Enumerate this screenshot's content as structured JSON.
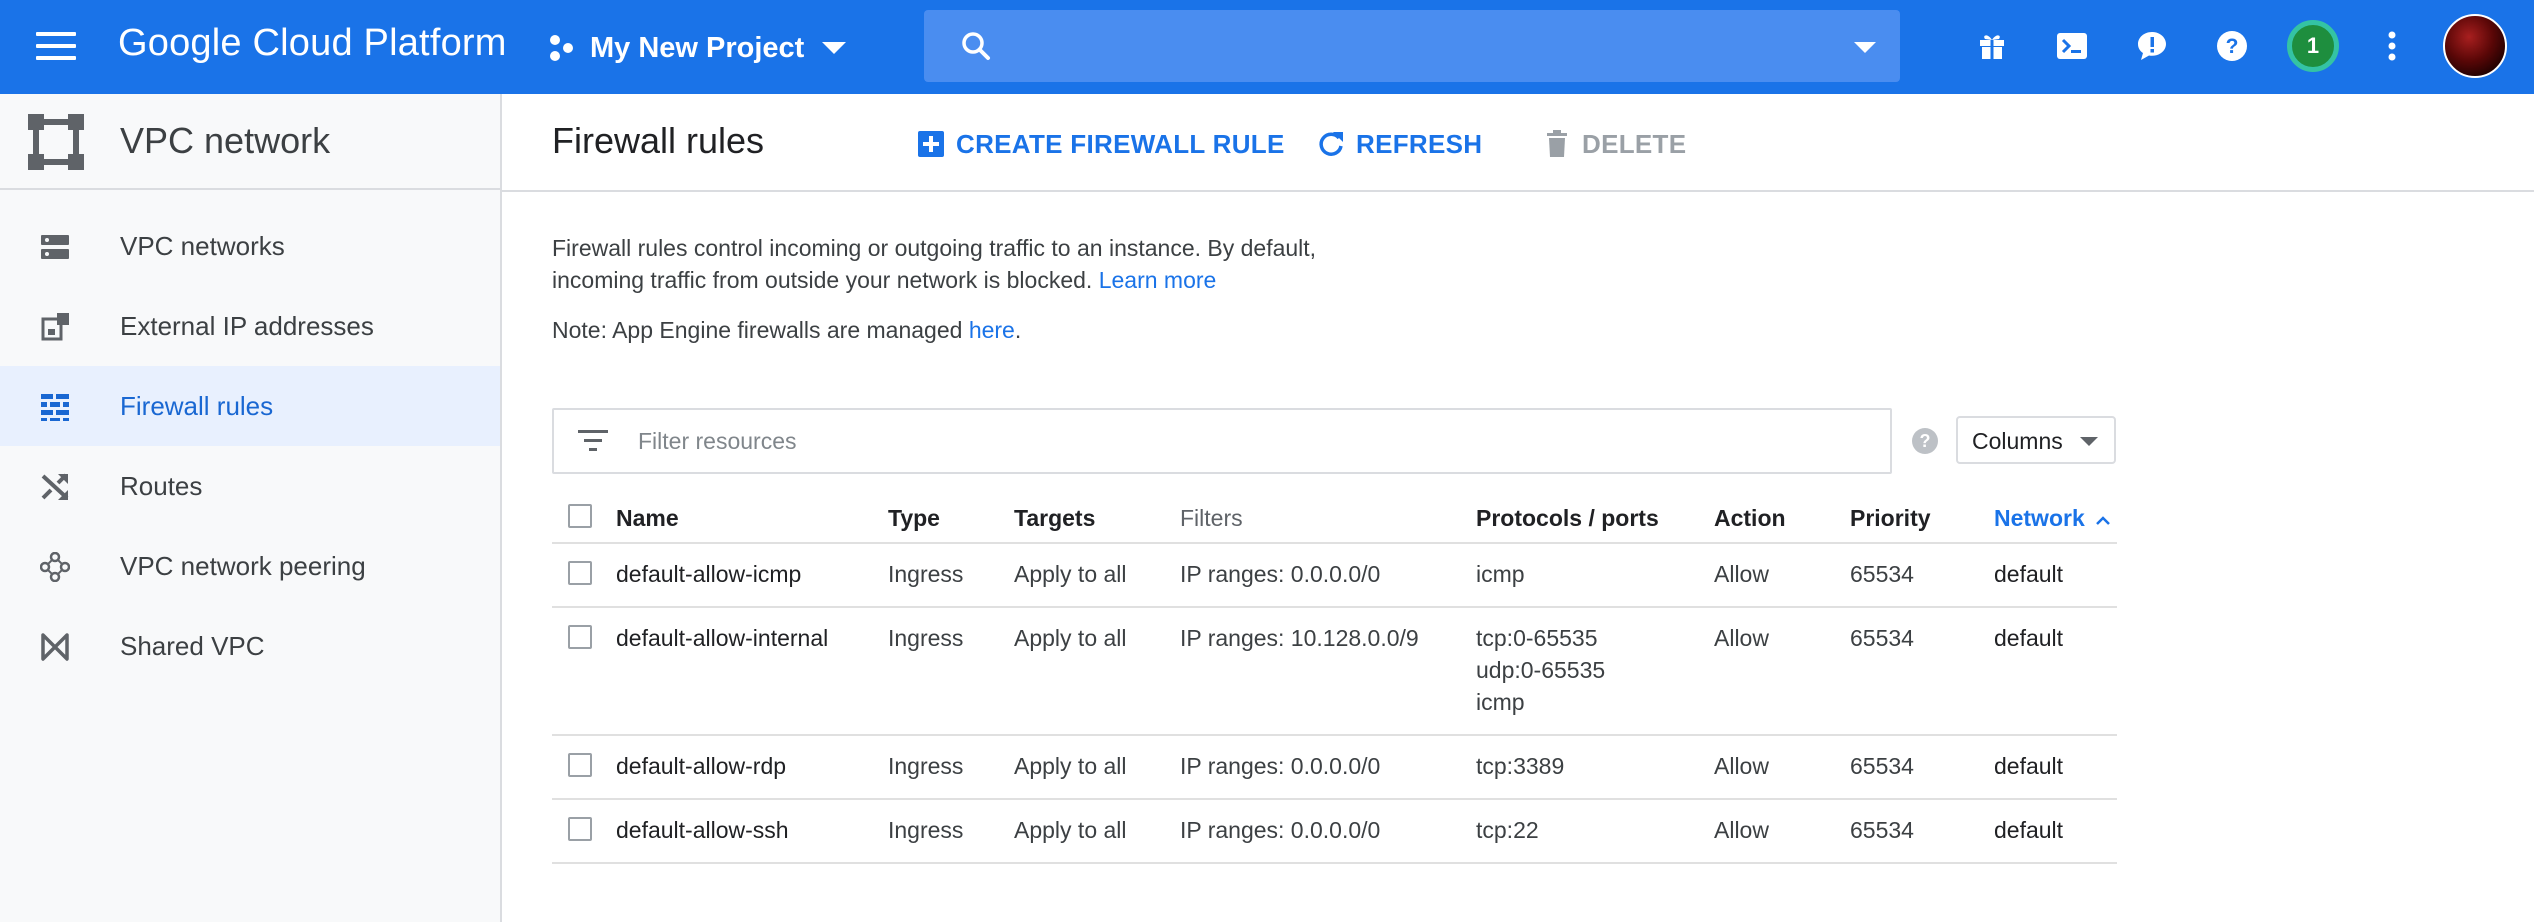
{
  "colors": {
    "topbar": "#1a73e8",
    "accent": "#1a73e8",
    "sidebar_bg": "#f8f9fa",
    "active_bg": "#e8f0fe",
    "notification_ring": "#34c3a4"
  },
  "topbar": {
    "menu_icon": "hamburger-menu-icon",
    "brand": "Google Cloud Platform",
    "project_name": "My New Project",
    "search_placeholder": "",
    "notification_count": "1",
    "icons": [
      "gift-icon",
      "cloud-shell-icon",
      "feedback-icon",
      "help-icon",
      "notifications-badge",
      "more-vert-icon",
      "account-avatar"
    ]
  },
  "sidebar": {
    "title": "VPC network",
    "items": [
      {
        "label": "VPC networks",
        "icon": "vpc-networks-icon"
      },
      {
        "label": "External IP addresses",
        "icon": "external-ip-icon"
      },
      {
        "label": "Firewall rules",
        "icon": "firewall-icon",
        "active": true
      },
      {
        "label": "Routes",
        "icon": "routes-icon"
      },
      {
        "label": "VPC network peering",
        "icon": "peering-icon"
      },
      {
        "label": "Shared VPC",
        "icon": "shared-vpc-icon"
      }
    ]
  },
  "main": {
    "title": "Firewall rules",
    "actions": {
      "create": "CREATE FIREWALL RULE",
      "refresh": "REFRESH",
      "delete": "DELETE"
    },
    "description_line1": "Firewall rules control incoming or outgoing traffic to an instance. By default,",
    "description_line2": "incoming traffic from outside your network is blocked.",
    "learn_more": "Learn more",
    "note_prefix": "Note: App Engine firewalls are managed",
    "note_link": "here",
    "note_suffix": ".",
    "filter_placeholder": "Filter resources",
    "help_glyph": "?",
    "columns_label": "Columns"
  },
  "table": {
    "headers": {
      "name": "Name",
      "type": "Type",
      "targets": "Targets",
      "filters": "Filters",
      "protocols": "Protocols / ports",
      "action": "Action",
      "priority": "Priority",
      "network": "Network"
    },
    "sort": {
      "column": "network",
      "direction": "ascending"
    },
    "rows": [
      {
        "name": "default-allow-icmp",
        "type": "Ingress",
        "targets": "Apply to all",
        "filters": "IP ranges: 0.0.0.0/0",
        "protocols": [
          "icmp"
        ],
        "action": "Allow",
        "priority": "65534",
        "network": "default"
      },
      {
        "name": "default-allow-internal",
        "type": "Ingress",
        "targets": "Apply to all",
        "filters": "IP ranges: 10.128.0.0/9",
        "protocols": [
          "tcp:0-65535",
          "udp:0-65535",
          "icmp"
        ],
        "action": "Allow",
        "priority": "65534",
        "network": "default"
      },
      {
        "name": "default-allow-rdp",
        "type": "Ingress",
        "targets": "Apply to all",
        "filters": "IP ranges: 0.0.0.0/0",
        "protocols": [
          "tcp:3389"
        ],
        "action": "Allow",
        "priority": "65534",
        "network": "default"
      },
      {
        "name": "default-allow-ssh",
        "type": "Ingress",
        "targets": "Apply to all",
        "filters": "IP ranges: 0.0.0.0/0",
        "protocols": [
          "tcp:22"
        ],
        "action": "Allow",
        "priority": "65534",
        "network": "default"
      }
    ]
  }
}
